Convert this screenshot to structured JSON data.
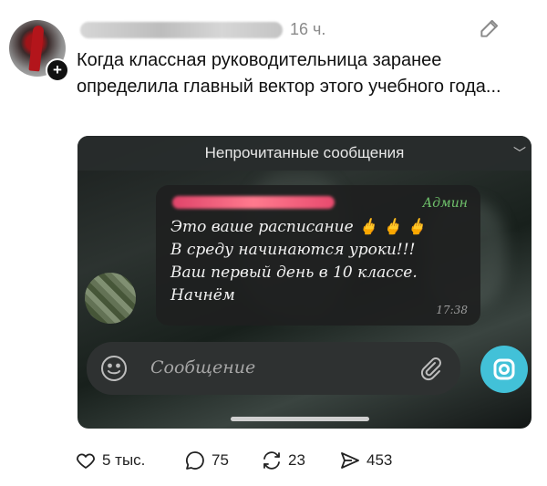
{
  "post": {
    "timestamp": "16 ч.",
    "caption": "Когда классная руководительница заранее определила главный вектор этого учебного года...",
    "follow_badge": "+"
  },
  "media": {
    "unread_label": "Непрочитанные сообщения",
    "message": {
      "role_badge": "Админ",
      "text": "Это ваше расписание 🖕 🖕 🖕\nВ среду начинаются уроки!!!\nВаш первый день в 10 классе.\nНачнём",
      "time": "17:38"
    },
    "composer_placeholder": "Сообщение"
  },
  "actions": {
    "likes": "5 тыс.",
    "comments": "75",
    "reposts": "23",
    "shares": "453"
  },
  "icons": [
    "edit-icon",
    "heart-icon",
    "comment-icon",
    "repost-icon",
    "share-icon",
    "smile-icon",
    "paperclip-icon",
    "camera-icon",
    "chevron-down-icon"
  ],
  "colors": {
    "admin": "#6fc26b",
    "camera": "#42c1d8",
    "meta": "#8a8a8a"
  }
}
